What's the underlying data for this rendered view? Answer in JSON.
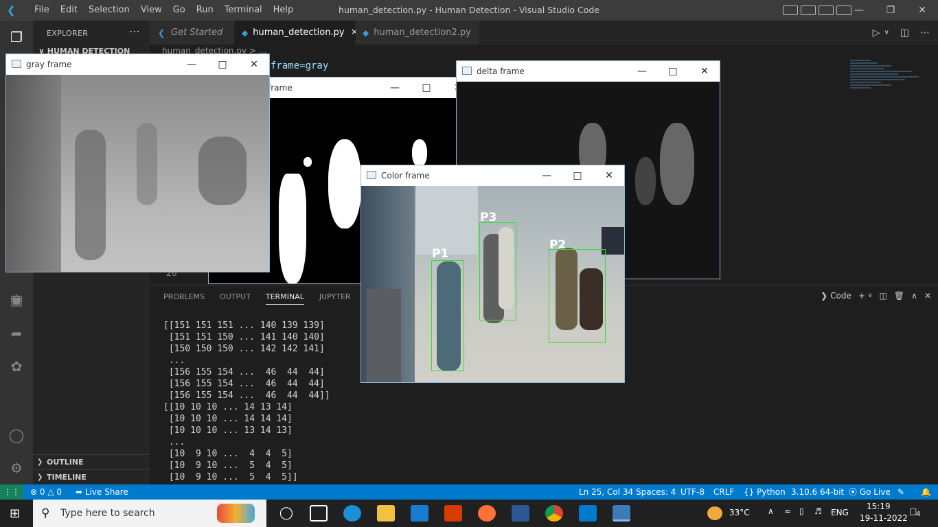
{
  "app": {
    "menu": [
      "File",
      "Edit",
      "Selection",
      "View",
      "Go",
      "Run",
      "Terminal",
      "Help"
    ],
    "window_title": "human_detection.py - Human Detection - Visual Studio Code"
  },
  "sidebar": {
    "title": "EXPLORER",
    "folder": "HUMAN DETECTION",
    "sections": {
      "outline": "OUTLINE",
      "timeline": "TIMELINE"
    }
  },
  "tabs": [
    {
      "label": "Get Started",
      "italic": true
    },
    {
      "label": "human_detection.py",
      "active": true
    },
    {
      "label": "human_detection2.py"
    }
  ],
  "editor": {
    "breadcrumb": "human_detection.py > ...",
    "visible_code": "frame=gray",
    "line_number": "26"
  },
  "panel": {
    "tabs": [
      "PROBLEMS",
      "OUTPUT",
      "TERMINAL",
      "JUPYTER"
    ],
    "active_tab": "TERMINAL",
    "terminal_profile": "Code",
    "terminal_lines": [
      "[[151 151 151 ... 140 139 139]",
      " [151 151 150 ... 141 140 140]",
      " [150 150 150 ... 142 142 141]",
      " ...",
      " [156 155 154 ...  46  44  44]",
      " [156 155 154 ...  46  44  44]",
      " [156 155 154 ...  46  44  44]]",
      "[[10 10 10 ... 14 13 14]",
      " [10 10 10 ... 14 14 14]",
      " [10 10 10 ... 13 14 13]",
      " ...",
      " [10  9 10 ...  4  4  5]",
      " [10  9 10 ...  5  4  5]",
      " [10  9 10 ...  5  4  5]]"
    ]
  },
  "windows": {
    "gray": {
      "title": "gray frame"
    },
    "threshold": {
      "title": "frame"
    },
    "delta": {
      "title": "delta frame"
    },
    "color": {
      "title": "Color frame",
      "labels": [
        "P1",
        "P2",
        "P3"
      ]
    }
  },
  "statusbar": {
    "errors": "0",
    "warnings": "0",
    "live_share": "Live Share",
    "position": "Ln 25, Col 34",
    "spaces": "Spaces: 4",
    "encoding": "UTF-8",
    "eol": "CRLF",
    "language": "Python",
    "interpreter": "3.10.6 64-bit",
    "go_live": "Go Live"
  },
  "taskbar": {
    "search_placeholder": "Type here to search",
    "weather": "33°C",
    "language": "ENG",
    "time": "15:19",
    "date": "19-11-2022",
    "notifications": "4"
  },
  "colors": {
    "accent": "#007acc",
    "box": "#2ee02e"
  }
}
